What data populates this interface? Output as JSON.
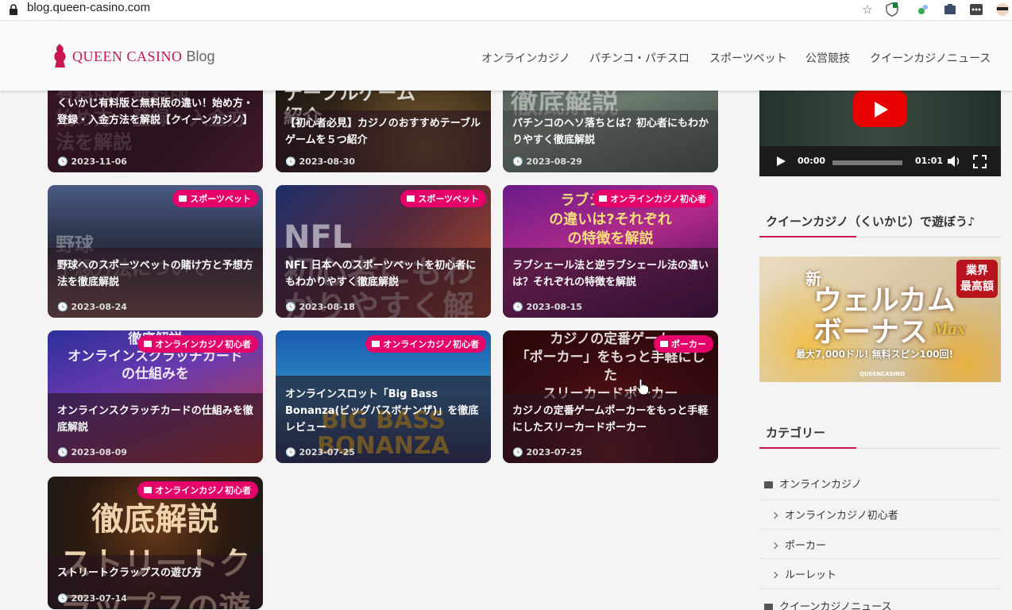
{
  "browser": {
    "url": "blog.queen-casino.com"
  },
  "header": {
    "logo_text": "QUEEN CASINO",
    "logo_blog": "Blog",
    "nav": [
      "オンラインカジノ",
      "パチンコ・パチスロ",
      "スポーツベット",
      "公営競技",
      "クイーンカジノニュース"
    ]
  },
  "cards": [
    {
      "title": "くいかじ有料版と無料版の違い！始め方・登録・入金方法を解説【クイーンカジノ】",
      "date": "2023-11-06",
      "badge": "",
      "bg": "有料版と無料版\n始め方・登録・入金方法を解説"
    },
    {
      "title": "【初心者必見】カジノのおすすめテーブルゲームを５つ紹介",
      "date": "2023-08-30",
      "badge": "",
      "bg": "テーブルゲーム\n紹介"
    },
    {
      "title": "パチンコのヘソ落ちとは？初心者にもわかりやすく徹底解説",
      "date": "2023-08-29",
      "badge": "",
      "bg": "徹底解説"
    },
    {
      "title": "野球へのスポーツベットの賭け方と予想方法を徹底解説",
      "date": "2023-08-24",
      "badge": "スポーツベット",
      "bg": "野球\n予想方法について"
    },
    {
      "title": "NFL 日本へのスポーツベットを初心者にもわかりやすく徹底解説",
      "date": "2023-08-18",
      "badge": "スポーツベット",
      "bg": "NFL\n初心者にもわかりやすく解説"
    },
    {
      "title": "ラブシェール法と逆ラブシェール法の違いは？それぞれの特徴を解説",
      "date": "2023-08-15",
      "badge": "オンラインカジノ初心者",
      "bg": "ラブシェール法\nの違いは?それぞれ\nの特徴を解説"
    },
    {
      "title": "オンラインスクラッチカードの仕組みを徹底解説",
      "date": "2023-08-09",
      "badge": "オンラインカジノ初心者",
      "bg": "徹底解説\nオンラインスクラッチカード\nの仕組みを"
    },
    {
      "title": "オンラインスロット「Big Bass Bonanza(ビッグバスボナンザ)」を徹底レビュー",
      "date": "2023-07-25",
      "badge": "オンラインカジノ初心者",
      "bg": "BIG BASS\nBONANZA"
    },
    {
      "title": "カジノの定番ゲームポーカーをもっと手軽にしたスリーカードポーカー",
      "date": "2023-07-25",
      "badge": "ポーカー",
      "bg": "カジノの定番ゲーム\n「ポーカー」をもっと手軽にした\nスリーカードポーカー"
    },
    {
      "title": "ストリートクラップスの遊び方",
      "date": "2023-07-14",
      "badge": "オンラインカジノ初心者",
      "bg": "徹底解説\nストリートクラップスの遊び方"
    }
  ],
  "video": {
    "time_current": "00:00",
    "time_total": "01:01"
  },
  "sidebar": {
    "play_heading": "クイーンカジノ（くいかじ）で遊ぼう♪",
    "banner": {
      "new": "新",
      "line1": "ウェルカム",
      "line2": "ボーナス",
      "max": "Max",
      "badge_line1": "業界",
      "badge_line2": "最高額",
      "detail": "最大7,000ドル! 無料スピン100回!",
      "brand": "QUEENCASINO"
    },
    "category_heading": "カテゴリー",
    "categories": [
      {
        "label": "オンラインカジノ",
        "level": 0
      },
      {
        "label": "オンラインカジノ初心者",
        "level": 1
      },
      {
        "label": "ポーカー",
        "level": 1
      },
      {
        "label": "ルーレット",
        "level": 1
      },
      {
        "label": "クイーンカジノニュース",
        "level": 0
      }
    ]
  },
  "colors": {
    "accent": "#c8174e",
    "badge": "#e5006a",
    "youtube_red": "#e60000"
  },
  "icons": [
    "lock-icon",
    "star-icon",
    "shield-icon",
    "extension-icon",
    "folder-icon",
    "play-icon",
    "volume-icon",
    "fullscreen-icon",
    "clock-icon",
    "chevron-right-icon",
    "hand-cursor-icon"
  ]
}
